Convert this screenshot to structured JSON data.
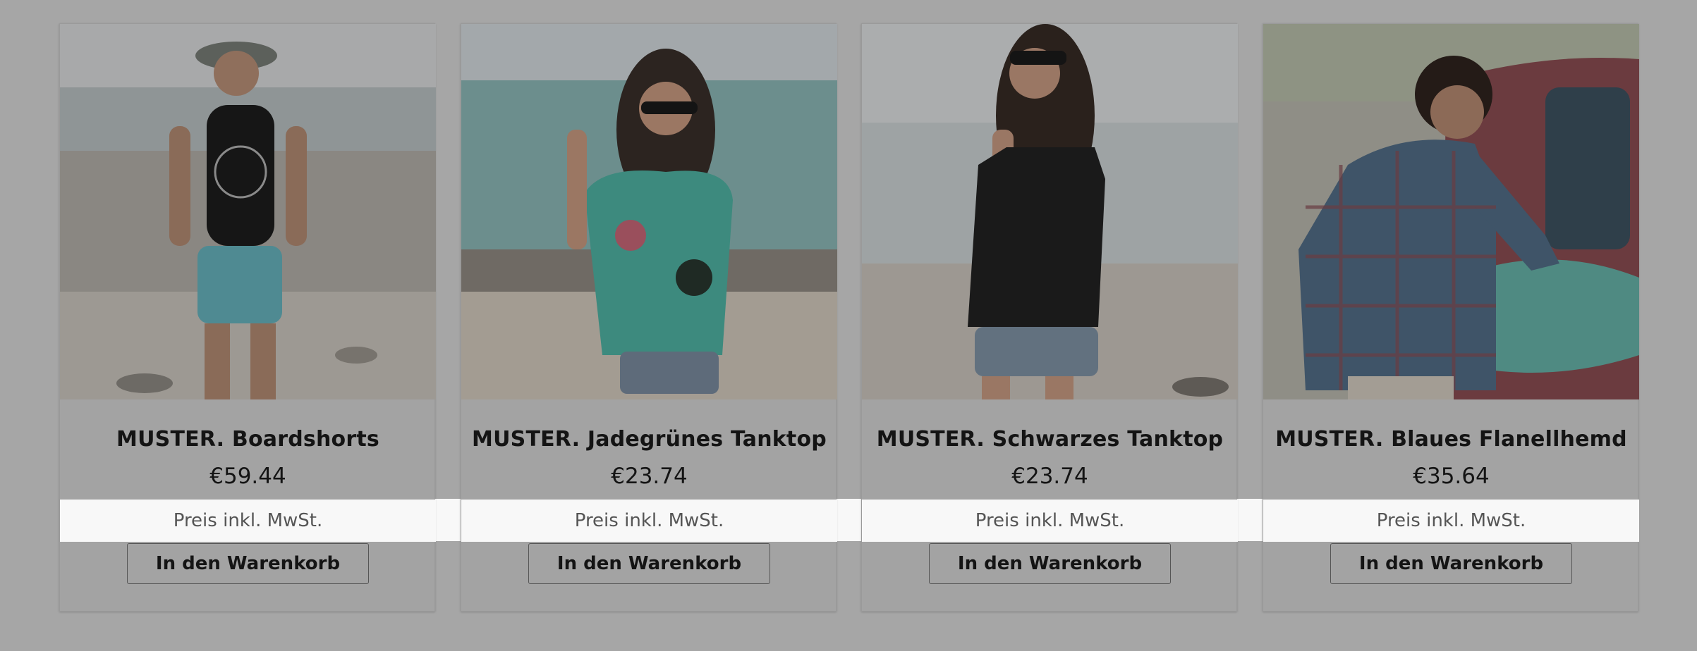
{
  "currency_note": "Preis inkl. MwSt.",
  "products": [
    {
      "title": "MUSTER. Boardshorts",
      "price": "€59.44",
      "vat_note": "Preis inkl. MwSt.",
      "cart_label": "In den Warenkorb"
    },
    {
      "title": "MUSTER. Jadegrünes Tanktop",
      "price": "€23.74",
      "vat_note": "Preis inkl. MwSt.",
      "cart_label": "In den Warenkorb"
    },
    {
      "title": "MUSTER. Schwarzes Tanktop",
      "price": "€23.74",
      "vat_note": "Preis inkl. MwSt.",
      "cart_label": "In den Warenkorb"
    },
    {
      "title": "MUSTER. Blaues Flanellhemd",
      "price": "€35.64",
      "vat_note": "Preis inkl. MwSt.",
      "cart_label": "In den Warenkorb"
    }
  ],
  "colors": {
    "overlay": "#a6a6a6",
    "highlight": "#f8f8f8",
    "text": "#141414"
  }
}
